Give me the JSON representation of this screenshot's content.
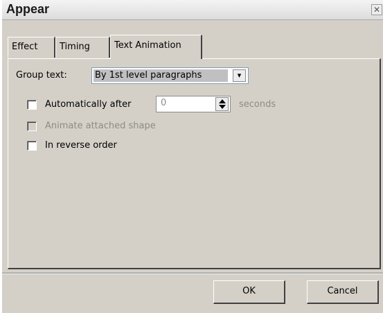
{
  "window": {
    "title": "Appear",
    "close_glyph": "✕"
  },
  "tabs": [
    {
      "label": "Effect",
      "active": false
    },
    {
      "label": "Timing",
      "active": false
    },
    {
      "label": "Text Animation",
      "active": true
    }
  ],
  "group_text": {
    "label": "Group text:",
    "selected": "By 1st level paragraphs",
    "dropdown_glyph": "▾"
  },
  "auto_after": {
    "label": "Automatically after",
    "checked": false,
    "value": "0",
    "units": "seconds",
    "enabled_input": false
  },
  "animate_shape": {
    "label": "Animate attached shape",
    "checked": false,
    "enabled": false
  },
  "reverse_order": {
    "label": "In reverse order",
    "checked": false
  },
  "buttons": {
    "ok": "OK",
    "cancel": "Cancel"
  }
}
